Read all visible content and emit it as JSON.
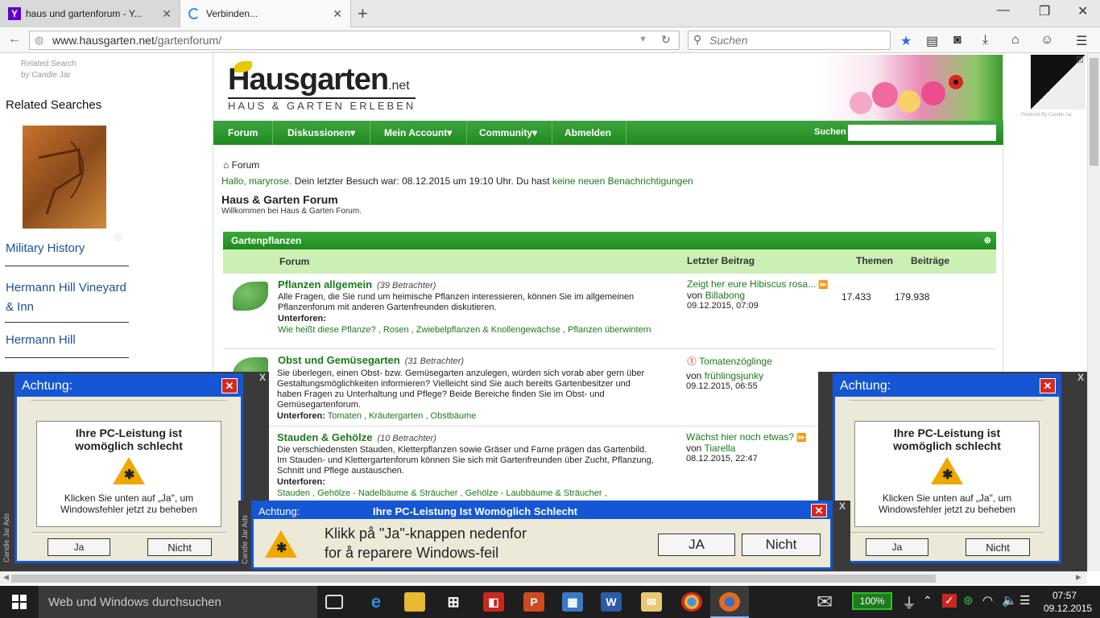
{
  "browser": {
    "tabs": [
      {
        "title": "haus und gartenforum - Y...",
        "favicon": "yahoo-icon"
      },
      {
        "title": "Verbinden...",
        "favicon": "loading-spinner"
      }
    ],
    "url_host": "www.hausgarten.net",
    "url_path": "/gartenforum/",
    "search_placeholder": "Suchen"
  },
  "left_ad": {
    "related_line1": "Related Search",
    "related_line2": "by Candle Jar",
    "heading": "Related Searches",
    "links": [
      "Military History",
      "Hermann Hill Vineyard & Inn",
      "Hermann Hill"
    ]
  },
  "forum": {
    "logo_main": "Hausgarten",
    "logo_net": ".net",
    "logo_sub": "HAUS & GARTEN ERLEBEN",
    "menu": [
      "Forum",
      "Diskussionen",
      "Mein Account",
      "Community",
      "Abmelden"
    ],
    "search_label": "Suchen",
    "breadcrumb": "Forum",
    "welcome_hello": "Hallo, maryrose.",
    "welcome_text": " Dein letzter Besuch war: 08.12.2015 um 19:10 Uhr. Du hast ",
    "welcome_link": "keine neuen Benachrichtigungen",
    "page_title": "Haus & Garten Forum",
    "page_subtitle": "Willkommen bei Haus & Garten Forum.",
    "category": "Gartenpflanzen",
    "columns": {
      "forum": "Forum",
      "last": "Letzter Beitrag",
      "threads": "Themen",
      "posts": "Beiträge"
    },
    "subforums_label": "Unterforen:",
    "rows": [
      {
        "title": "Pflanzen allgemein",
        "views": "(39 Betrachter)",
        "desc": "Alle Fragen, die Sie rund um heimische Pflanzen interessieren, können Sie im allgemeinen Pflanzenforum mit anderen Gartenfreunden diskutieren.",
        "subforums": "Wie heißt diese Pflanze? ,  Rosen ,  Zwiebelpflanzen & Knollengewächse ,  Pflanzen überwintern",
        "last_title": "Zeigt her eure Hibiscus rosa...",
        "last_by": "Billabong",
        "last_date": "09.12.2015, 07:09",
        "threads": "17.433",
        "posts": "179.938"
      },
      {
        "title": "Obst und Gemüsegarten",
        "views": "(31 Betrachter)",
        "desc": "Sie überlegen, einen Obst- bzw. Gemüsegarten anzulegen, würden sich vorab aber gern über Gestaltungsmöglichkeiten informieren? Vielleicht sind Sie auch bereits Gartenbesitzer und haben Fragen zu Unterhaltung und Pflege? Beide Bereiche finden Sie im Obst- und Gemüsegartenforum.",
        "subforums": "Tomaten ,  Kräutergarten ,  Obstbäume",
        "last_title": "Tomatenzöglinge",
        "last_by": "frühlingsjunky",
        "last_date": "09.12.2015, 06:55",
        "threads": "",
        "posts": ""
      },
      {
        "title": "Stauden & Gehölze",
        "views": "(10 Betrachter)",
        "desc": "Die verschiedensten Stauden, Kletterpflanzen sowie Gräser und Farne prägen das Gartenbild. Im Stauden- und Klettergartenforum können Sie sich mit Gartenfreunden über Zucht, Pflanzung, Schnitt und Pflege austauschen.",
        "subforums": "Stauden ,  Gehölze - Nadelbäume & Sträucher ,  Gehölze - Laubbäume & Sträucher ,",
        "last_title": "Wächst hier noch etwas?",
        "last_by": "Tiarella",
        "last_date": "08.12.2015, 22:47",
        "threads": "",
        "posts": ""
      }
    ],
    "von": "von"
  },
  "right_ad": {
    "powered": "Powered By Candle Jar"
  },
  "popup_left": {
    "title": "Achtung:",
    "line1": "Ihre PC-Leistung ist",
    "line2": "womöglich schlecht",
    "body1": "Klicken Sie unten auf „Ja\", um",
    "body2": "Windowsfehler jetzt zu beheben",
    "yes": "Ja",
    "no": "Nicht",
    "adlabel": "Candle Jar Ads"
  },
  "popup_center": {
    "title_left": "Achtung:",
    "title_center": "Ihre PC-Leistung Ist Womöglich Schlecht",
    "line1": "Klikk på \"Ja\"-knappen nedenfor",
    "line2": "for å reparere Windows-feil",
    "yes": "JA",
    "no": "Nicht",
    "adlabel": "Candle Jar Ads"
  },
  "taskbar": {
    "search": "Web und Windows durchsuchen",
    "battery": "100%",
    "time": "07:57",
    "date": "09.12.2015"
  }
}
